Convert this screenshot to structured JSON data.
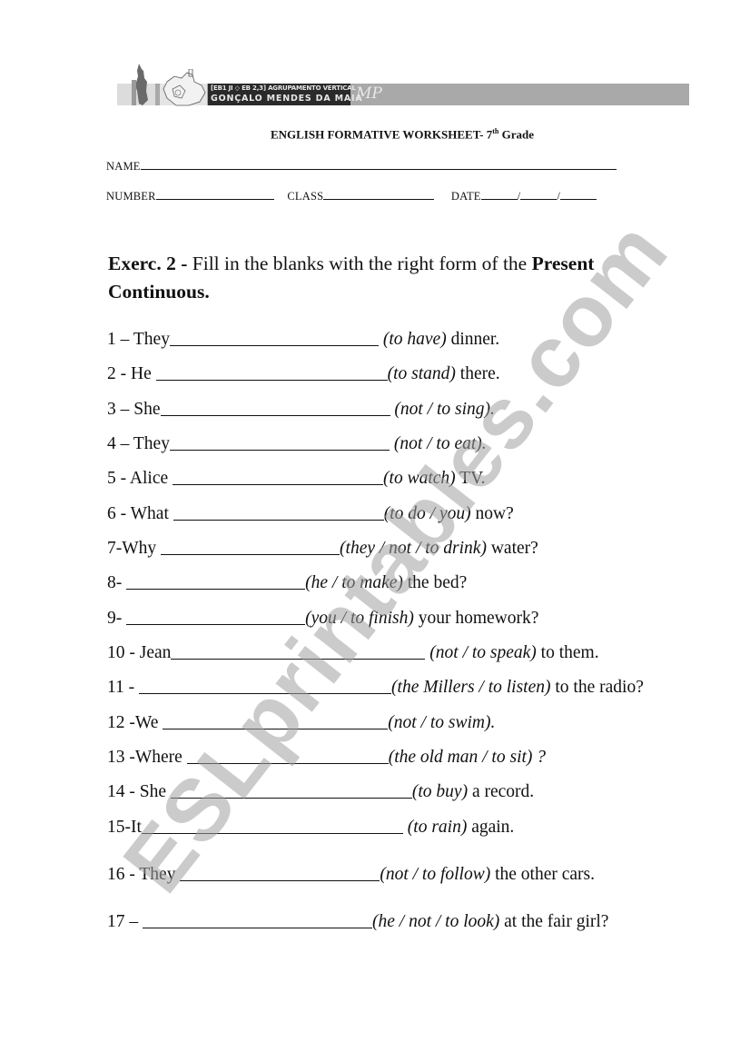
{
  "header": {
    "school_line1": "[EB1 JI ◇ EB 2,3]  AGRUPAMENTO VERTICAL",
    "school_line2": "GONÇALO MENDES DA MAIA",
    "monogram": "MP"
  },
  "title": {
    "main": "ENGLISH FORMATIVE WORKSHEET- 7",
    "sup": "th",
    "tail": " Grade"
  },
  "fields": {
    "name_label": "NAME",
    "number_label": "NUMBER",
    "class_label": "CLASS",
    "date_label": "DATE",
    "date_sep": "/"
  },
  "exercise": {
    "label": "Exerc. 2",
    "dash": " - ",
    "instruction": "Fill in the blanks with the right form of the ",
    "tense": "Present Continuous."
  },
  "items": [
    {
      "prefix": "1 – They",
      "hint": "(to have)",
      "suffix": " dinner."
    },
    {
      "prefix": "2 - He ",
      "hint": "(to stand)",
      "suffix": " there."
    },
    {
      "prefix": "3 – She",
      "hint": "(not / to sing).",
      "suffix": ""
    },
    {
      "prefix": "4 – They",
      "hint": "(not / to eat).",
      "suffix": ""
    },
    {
      "prefix": "5 - Alice ",
      "hint": "(to watch)",
      "suffix": " TV."
    },
    {
      "prefix": "6 - What ",
      "hint": "(to do / you)",
      "suffix": " now?"
    },
    {
      "prefix": "7-Why ",
      "hint": "(they / not / to drink)",
      "suffix": " water?"
    },
    {
      "prefix": "8- ",
      "hint": "(he / to make)",
      "suffix": " the bed?"
    },
    {
      "prefix": "9- ",
      "hint": "(you / to finish)",
      "suffix": " your homework?"
    },
    {
      "prefix": "10 - Jean",
      "hint": "(not / to speak)",
      "suffix": " to them."
    },
    {
      "prefix": "11 - ",
      "hint": "(the Millers / to listen)",
      "suffix": " to the radio?"
    },
    {
      "prefix": "12 -We ",
      "hint": "(not / to swim).",
      "suffix": ""
    },
    {
      "prefix": "13 -Where ",
      "hint": "(the old man / to sit) ?",
      "suffix": ""
    },
    {
      "prefix": "14 - She ",
      "hint": "(to buy)",
      "suffix": " a record."
    },
    {
      "prefix": "15-It",
      "hint": "(to rain)",
      "suffix": " again."
    },
    {
      "prefix": "16 - They ",
      "hint": "(not / to follow)",
      "suffix": " the other cars."
    },
    {
      "prefix": "17 – ",
      "hint": "(he / not / to look)",
      "suffix": " at the fair girl?"
    }
  ],
  "watermark": "ESLprintables.com"
}
